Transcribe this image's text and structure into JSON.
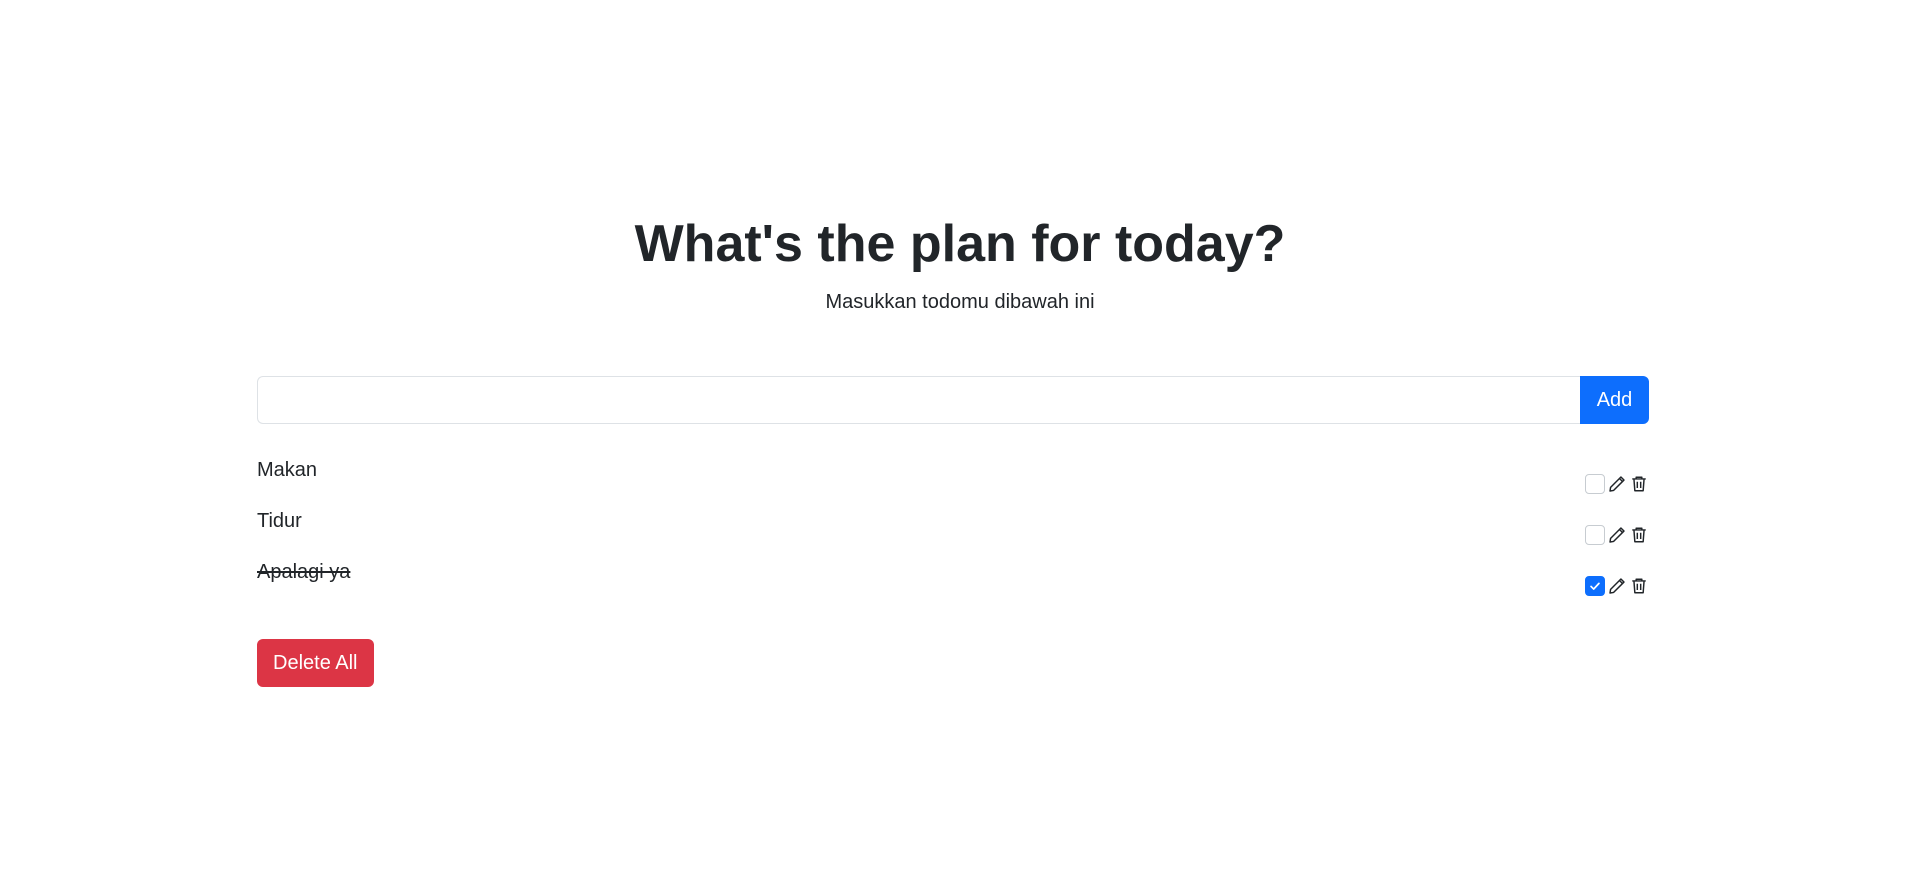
{
  "header": {
    "title": "What's the plan for today?",
    "subtitle": "Masukkan todomu dibawah ini"
  },
  "form": {
    "input_value": "",
    "input_placeholder": "",
    "add_label": "Add"
  },
  "todos": [
    {
      "text": "Makan",
      "done": false
    },
    {
      "text": "Tidur",
      "done": false
    },
    {
      "text": "Apalagi ya",
      "done": true
    }
  ],
  "footer": {
    "delete_all_label": "Delete All"
  },
  "icons": {
    "edit": "pencil-icon",
    "delete": "trash-icon",
    "checkmark": "check-icon"
  },
  "colors": {
    "primary": "#0d6efd",
    "danger": "#dc3545",
    "text": "#212529",
    "border": "#dee2e6"
  }
}
